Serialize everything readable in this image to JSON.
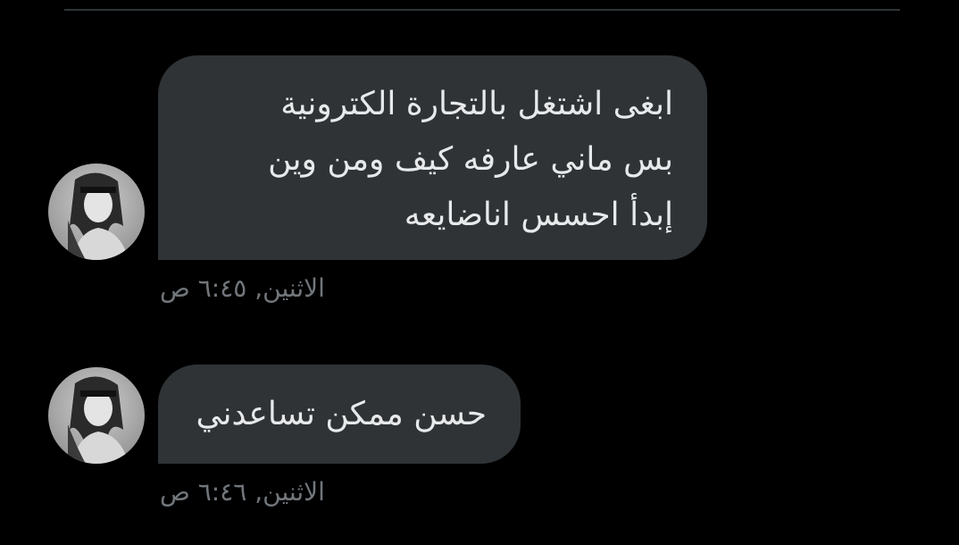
{
  "messages": [
    {
      "lines": [
        "ابغى اشتغل بالتجارة الكترونية",
        "بس ماني عارفه كيف ومن وين",
        "إبدأ احسس اناضايعه"
      ],
      "timestamp": "الاثنين, ٦:٤٥ ص"
    },
    {
      "lines": [
        "حسن ممكن تساعدني"
      ],
      "timestamp": "الاثنين, ٦:٤٦ ص"
    }
  ],
  "colors": {
    "background": "#000000",
    "bubble": "#2f3336",
    "text": "#e7e9ea",
    "timestamp": "#71767b",
    "divider": "#2f3336"
  },
  "icons": {
    "avatar": "grayscale-profile-photo"
  }
}
